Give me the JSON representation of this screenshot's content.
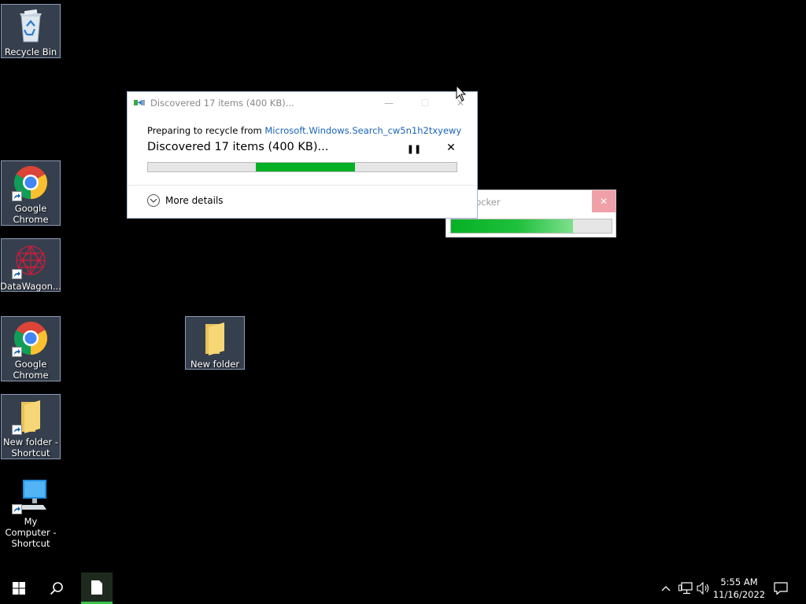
{
  "desktop": {
    "icons": [
      {
        "label": "Recycle Bin"
      },
      {
        "label": "Google Chrome"
      },
      {
        "label": "DataWagon..."
      },
      {
        "label": "Google Chrome"
      },
      {
        "label": "New folder - Shortcut"
      },
      {
        "label": "My Computer - Shortcut"
      },
      {
        "label": "New folder"
      }
    ]
  },
  "dialog": {
    "title": "Discovered 17 items (400 KB)...",
    "preparing_prefix": "Preparing to recycle from ",
    "source_link": "Microsoft.Windows.Search_cw5n1h2txyewy",
    "status": "Discovered 17 items (400 KB)...",
    "progress": {
      "start_fraction": 0.35,
      "end_fraction": 0.67
    },
    "more_details": "More details",
    "pause_icon": "pause-icon",
    "cancel_icon": "close-icon"
  },
  "second_window": {
    "title_fragment": "locker",
    "progress_fraction": 0.76
  },
  "taskbar": {
    "time": "5:55 AM",
    "date": "11/16/2022"
  },
  "colors": {
    "progress_green": "#06b025",
    "link_blue": "#1a64b4",
    "desktop_bg": "#000000"
  }
}
